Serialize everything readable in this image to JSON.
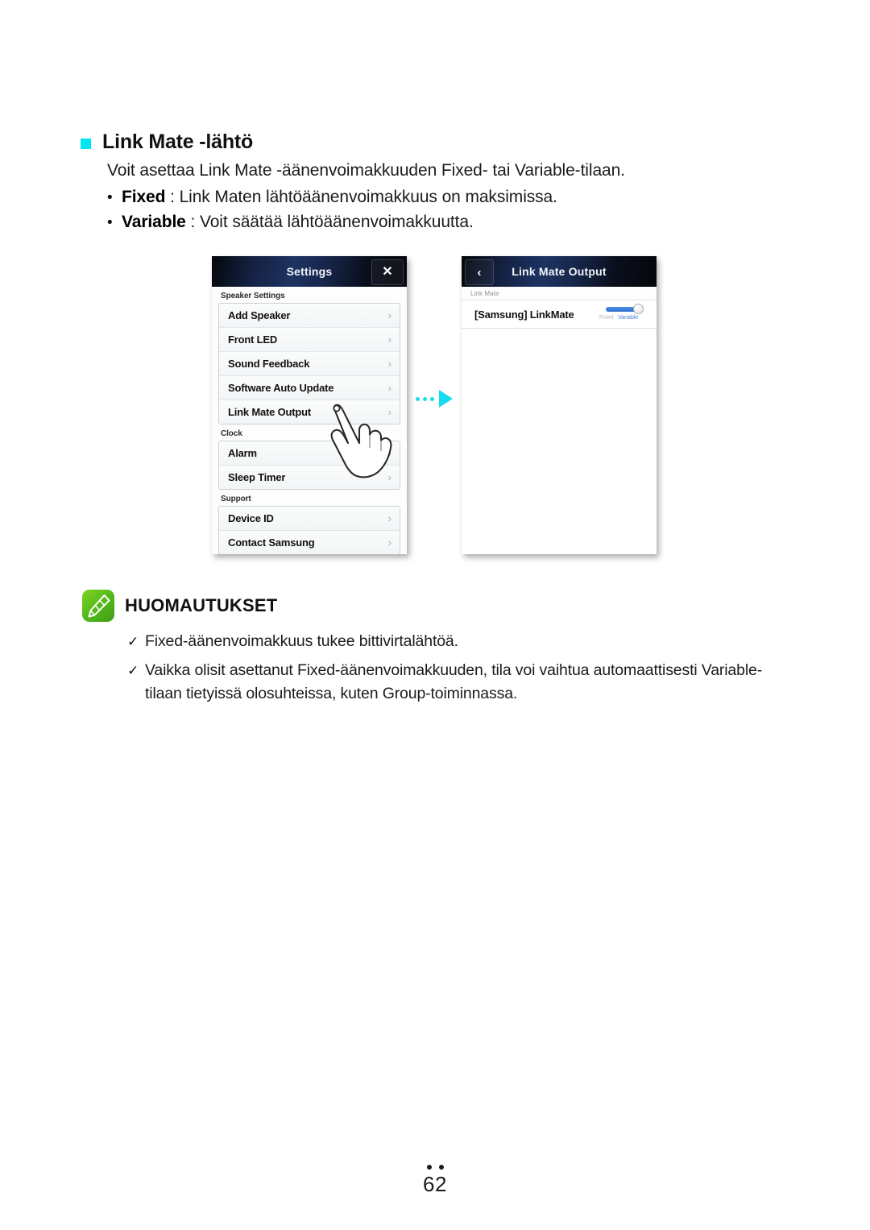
{
  "heading": {
    "marker_color": "#00e5ef",
    "title": "Link Mate -lähtö"
  },
  "intro": "Voit asettaa Link Mate -äänenvoimakkuuden Fixed- tai Variable-tilaan.",
  "definitions": [
    {
      "bullet": "•",
      "term": "Fixed",
      "rest": " : Link Maten lähtöäänenvoimakkuus on maksimissa."
    },
    {
      "bullet": "•",
      "term": "Variable",
      "rest": " : Voit säätää lähtöäänenvoimakkuutta."
    }
  ],
  "settings_panel": {
    "header": {
      "title": "Settings",
      "close_label": "✕"
    },
    "sections": [
      {
        "label": "Speaker Settings",
        "rows": [
          {
            "label": "Add Speaker",
            "chevron": "›"
          },
          {
            "label": "Front LED",
            "chevron": "›"
          },
          {
            "label": "Sound Feedback",
            "chevron": "›"
          },
          {
            "label": "Software Auto Update",
            "chevron": "›"
          },
          {
            "label": "Link Mate Output",
            "chevron": "›"
          }
        ]
      },
      {
        "label": "Clock",
        "rows": [
          {
            "label": "Alarm",
            "chevron": "›"
          },
          {
            "label": "Sleep Timer",
            "chevron": "›"
          }
        ]
      },
      {
        "label": "Support",
        "rows": [
          {
            "label": "Device ID",
            "chevron": "›"
          },
          {
            "label": "Contact Samsung",
            "chevron": "›"
          }
        ]
      }
    ]
  },
  "arrow": {
    "color": "#16dcf0",
    "dots": 3
  },
  "output_panel": {
    "header": {
      "back_label": "‹",
      "title": "Link Mate Output"
    },
    "section_label": "Link Mate",
    "row": {
      "label": "[Samsung] LinkMate",
      "switch": {
        "state": "Variable",
        "label_left": "Fixed",
        "label_right": "Variable",
        "track_color": "#3a7ad9"
      }
    }
  },
  "notes": {
    "title": "HUOMAUTUKSET",
    "icon_color": "#5bb61b",
    "items": [
      {
        "check": "✓",
        "text": "Fixed-äänenvoimakkuus tukee bittivirtalähtöä."
      },
      {
        "check": "✓",
        "text": "Vaikka olisit asettanut Fixed-äänenvoimakkuuden, tila voi vaihtua automaattisesti Variable-tilaan tietyissä olosuhteissa, kuten Group-toiminnassa."
      }
    ]
  },
  "footer": {
    "page_number": "62",
    "dots": 2
  }
}
